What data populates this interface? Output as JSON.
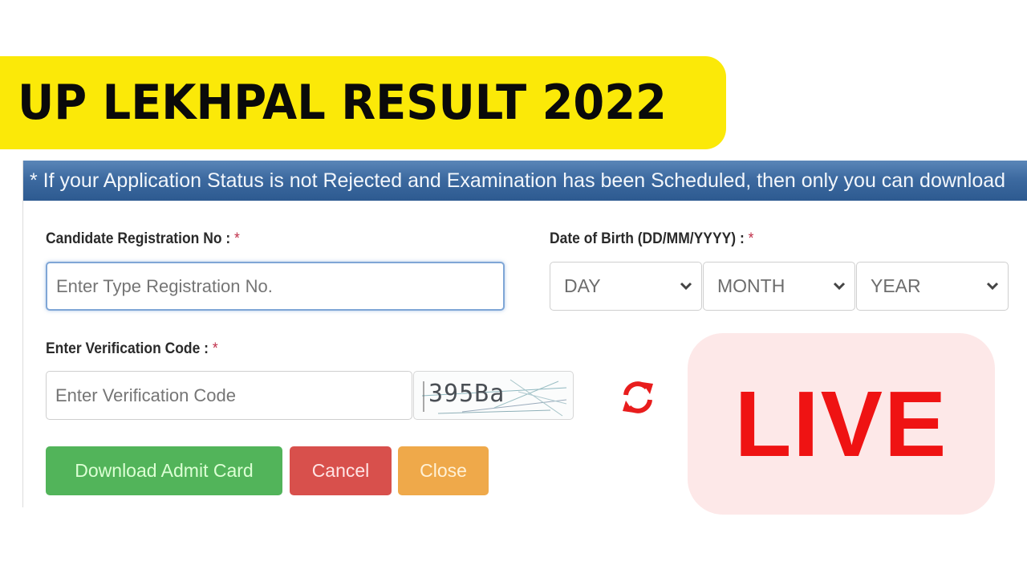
{
  "headline": {
    "title": "UP LEKHPAL RESULT 2022",
    "bg_color": "#fbe908"
  },
  "notice": {
    "text": "* If your Application Status is not Rejected and Examination has been Scheduled, then only you can download"
  },
  "form": {
    "registration": {
      "label": "Candidate Registration No :",
      "required_mark": "*",
      "placeholder": "Enter Type Registration No.",
      "value": ""
    },
    "dob": {
      "label": "Date of Birth (DD/MM/YYYY) :",
      "required_mark": "*",
      "day": {
        "selected": "DAY"
      },
      "month": {
        "selected": "MONTH"
      },
      "year": {
        "selected": "YEAR"
      }
    },
    "verification": {
      "label": "Enter Verification Code :",
      "required_mark": "*",
      "placeholder": "Enter Verification Code",
      "value": "",
      "captcha_text": "395Ba",
      "refresh_icon": "refresh-icon"
    },
    "buttons": {
      "download": "Download Admit Card",
      "cancel": "Cancel",
      "close": "Close"
    }
  },
  "badge": {
    "text": "LIVE",
    "color": "#ef1313"
  },
  "colors": {
    "success": "#52b45a",
    "danger": "#d8504c",
    "warning": "#efa94a",
    "notice_bar": "#3d6aa0"
  }
}
